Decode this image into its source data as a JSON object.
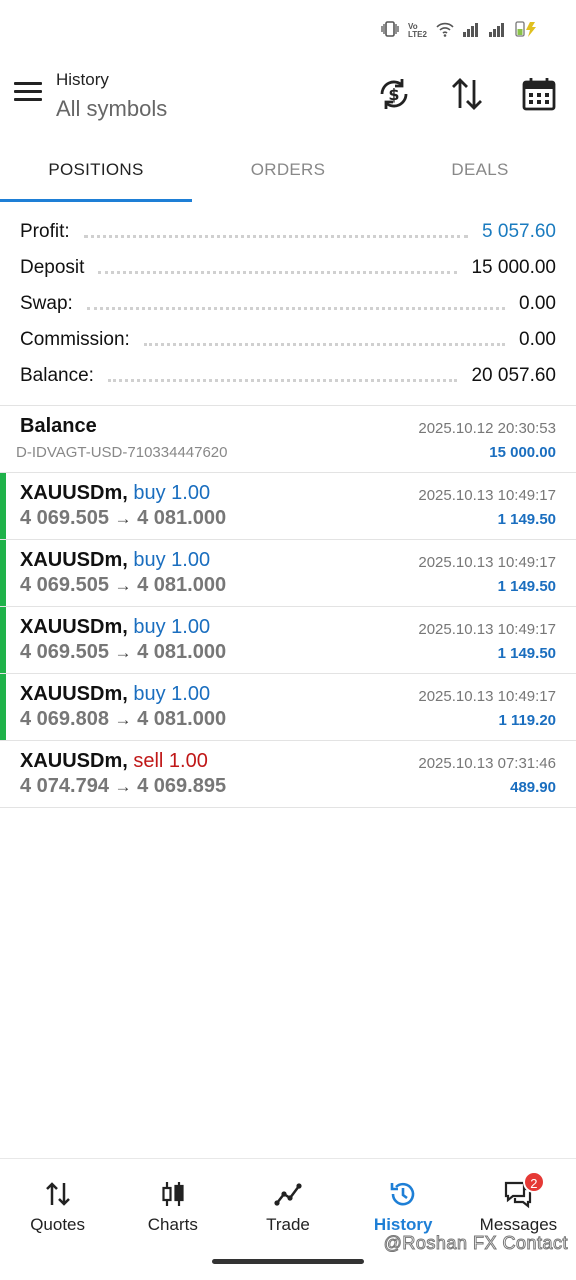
{
  "status": {
    "carrier": "Vo LTE2"
  },
  "header": {
    "title": "History",
    "subtitle": "All symbols"
  },
  "tabs": [
    {
      "label": "POSITIONS",
      "active": true
    },
    {
      "label": "ORDERS",
      "active": false
    },
    {
      "label": "DEALS",
      "active": false
    }
  ],
  "summary": {
    "profit_label": "Profit:",
    "profit_value": "5 057.60",
    "deposit_label": "Deposit",
    "deposit_value": "15 000.00",
    "swap_label": "Swap:",
    "swap_value": "0.00",
    "commission_label": "Commission:",
    "commission_value": "0.00",
    "balance_label": "Balance:",
    "balance_value": "20 057.60"
  },
  "balance_entry": {
    "title": "Balance",
    "account": "D-IDVAGT-USD-710334447620",
    "time": "2025.10.12 20:30:53",
    "amount": "15 000.00"
  },
  "positions": [
    {
      "symbol": "XAUUSDm,",
      "action": "buy 1.00",
      "prices": "4 069.505",
      "arrow": "→",
      "close": "4 081.000",
      "time": "2025.10.13 10:49:17",
      "profit": "1 149.50"
    },
    {
      "symbol": "XAUUSDm,",
      "action": "buy 1.00",
      "prices": "4 069.505",
      "arrow": "→",
      "close": "4 081.000",
      "time": "2025.10.13 10:49:17",
      "profit": "1 149.50"
    },
    {
      "symbol": "XAUUSDm,",
      "action": "buy 1.00",
      "prices": "4 069.505",
      "arrow": "→",
      "close": "4 081.000",
      "time": "2025.10.13 10:49:17",
      "profit": "1 149.50"
    },
    {
      "symbol": "XAUUSDm,",
      "action": "buy 1.00",
      "prices": "4 069.808",
      "arrow": "→",
      "close": "4 081.000",
      "time": "2025.10.13 10:49:17",
      "profit": "1 119.20"
    },
    {
      "symbol": "XAUUSDm,",
      "action": "sell 1.00",
      "prices": "4 074.794",
      "arrow": "→",
      "close": "4 069.895",
      "time": "2025.10.13 07:31:46",
      "profit": "489.90"
    }
  ],
  "nav": [
    {
      "label": "Quotes",
      "icon": "quotes-icon"
    },
    {
      "label": "Charts",
      "icon": "charts-icon"
    },
    {
      "label": "Trade",
      "icon": "trade-icon"
    },
    {
      "label": "History",
      "icon": "history-icon",
      "active": true
    },
    {
      "label": "Messages",
      "icon": "messages-icon",
      "badge": "2"
    }
  ],
  "watermark": "@Roshan FX Contact",
  "colors": {
    "accent": "#1e7fd6",
    "buy": "#1a6ebf",
    "sell": "#c01818",
    "profit_bar": "#1fb24a"
  }
}
